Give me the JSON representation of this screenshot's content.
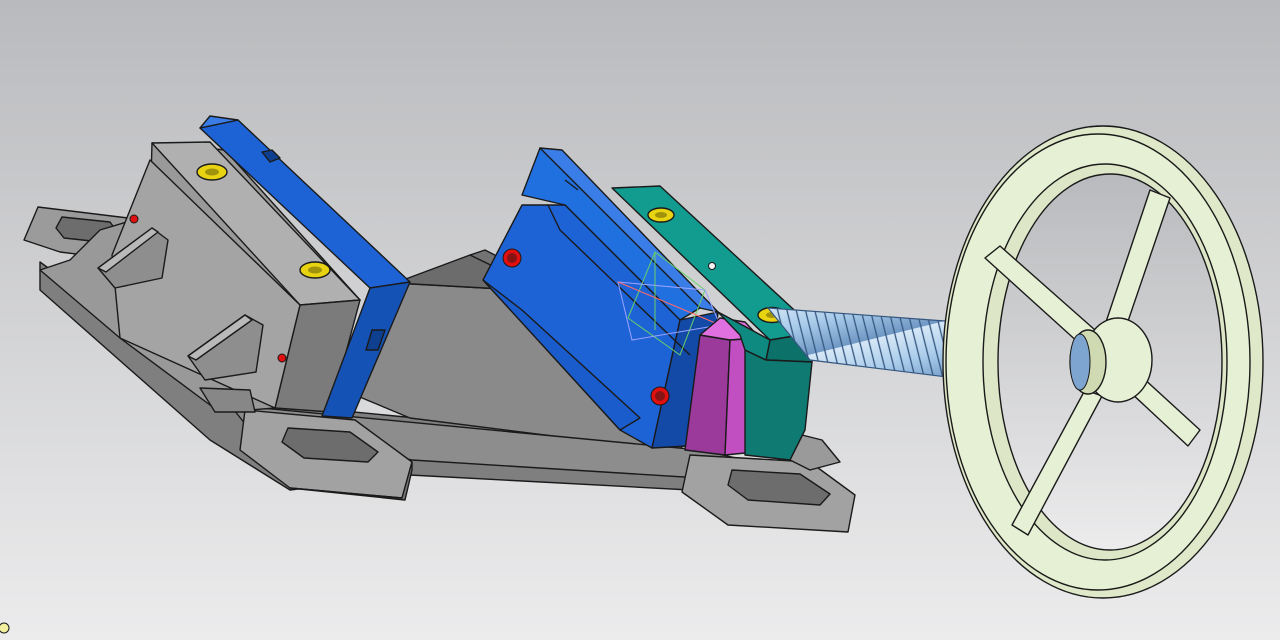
{
  "viewport": {
    "background_top": "#b9babd",
    "background_bottom": "#ececed"
  },
  "model": {
    "parts": [
      {
        "name": "base-body",
        "color": "#9a9a9a"
      },
      {
        "name": "fixed-jaw-body",
        "color": "#8f8f8f"
      },
      {
        "name": "fixed-jaw-plate",
        "color": "#1d63d6"
      },
      {
        "name": "movable-jaw-plate",
        "color": "#1d63d6"
      },
      {
        "name": "jaw-spacer",
        "color": "#c24fc2"
      },
      {
        "name": "screw-nut-block",
        "color": "#0f8a80"
      },
      {
        "name": "lead-screw",
        "color": "#9dc4e8"
      },
      {
        "name": "handwheel",
        "color": "#e6f0d4"
      }
    ],
    "fastener_color": "#e8d313",
    "pin_color": "#e01010",
    "selection_triad_colors": [
      "#66d06a",
      "#9aa3ff",
      "#ff6a6a"
    ]
  }
}
